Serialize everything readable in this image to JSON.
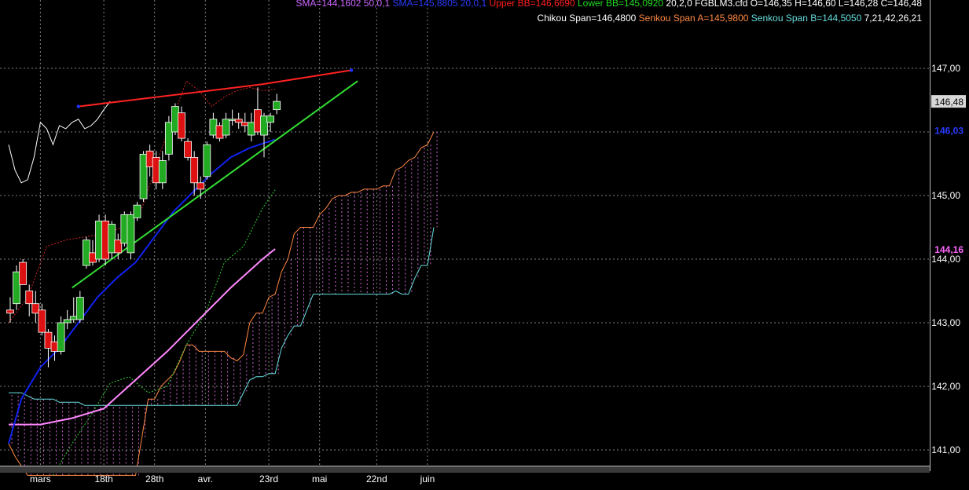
{
  "header": {
    "line1": [
      {
        "text": "SMA=144,1602  50,0,1",
        "color": "#cc66ff"
      },
      {
        "text": "SMA=145,8805  20,0,1",
        "color": "#2a3bff"
      },
      {
        "text": "Upper BB=146,6690",
        "color": "#ff2020"
      },
      {
        "text": "Lower BB=145,0920",
        "color": "#22dd22"
      },
      {
        "text": "20,2,0",
        "color": "#ffffff"
      },
      {
        "text": "FGBLM3.cfd O=146,35 H=146,60 L=146,28 C=146,48",
        "color": "#ffffff"
      }
    ],
    "line2": [
      {
        "text": "Chikou Span=146,4800",
        "color": "#ffffff"
      },
      {
        "text": "Senkou Span A=145,9800",
        "color": "#ff8844"
      },
      {
        "text": "Senkou Span B=144,5050",
        "color": "#66dddd"
      },
      {
        "text": "7,21,42,26,21",
        "color": "#ffffff"
      }
    ]
  },
  "price_badges": [
    {
      "label": "146,48",
      "value": 146.48,
      "bg": "#d8d8d8",
      "fg": "#000000"
    },
    {
      "label": "146,03",
      "value": 146.03,
      "bg": "#000000",
      "fg": "#2a3bff"
    },
    {
      "label": "144,16",
      "value": 144.16,
      "bg": "#000000",
      "fg": "#ff66ff"
    }
  ],
  "colors": {
    "up": "#22aa22",
    "down": "#dd1111",
    "sma50": "#ff88ff",
    "sma20": "#1122ee",
    "bb": "#cc2222",
    "bb_lower": "#33cc33",
    "chikou": "#ffffff",
    "senkou_a": "#ff8844",
    "senkou_b": "#66dddd",
    "cloud": "#cc66cc",
    "trend_red": "#ff2222",
    "trend_green": "#33dd33",
    "grid": "#808080"
  },
  "chart_data": {
    "type": "candlestick",
    "title": "",
    "xlabel": "",
    "ylabel": "",
    "ylim": [
      140.6,
      147.6
    ],
    "grid": true,
    "yticks": [
      141,
      142,
      143,
      144,
      145,
      146,
      147
    ],
    "ytick_labels": [
      "141,00",
      "142,00",
      "143,00",
      "144,00",
      "145,00",
      "146,00",
      "147,00"
    ],
    "x_count": 84,
    "xticks": [
      {
        "label": "mars",
        "i": 5
      },
      {
        "label": "18th",
        "i": 15
      },
      {
        "label": "28th",
        "i": 23
      },
      {
        "label": "avr.",
        "i": 31
      },
      {
        "label": "23rd",
        "i": 41
      },
      {
        "label": "mai",
        "i": 49
      },
      {
        "label": "22nd",
        "i": 58
      },
      {
        "label": "juin",
        "i": 66
      }
    ],
    "candles": [
      {
        "i": 0,
        "o": 143.2,
        "h": 143.4,
        "l": 143.0,
        "c": 143.15
      },
      {
        "i": 1,
        "o": 143.3,
        "h": 143.9,
        "l": 143.2,
        "c": 143.8
      },
      {
        "i": 2,
        "o": 143.95,
        "h": 144.0,
        "l": 143.6,
        "c": 143.6
      },
      {
        "i": 3,
        "o": 143.5,
        "h": 143.6,
        "l": 143.1,
        "c": 143.3
      },
      {
        "i": 4,
        "o": 143.3,
        "h": 143.5,
        "l": 143.0,
        "c": 143.15
      },
      {
        "i": 5,
        "o": 143.2,
        "h": 143.3,
        "l": 142.8,
        "c": 142.85
      },
      {
        "i": 6,
        "o": 142.85,
        "h": 142.9,
        "l": 142.3,
        "c": 142.6
      },
      {
        "i": 7,
        "o": 142.7,
        "h": 142.8,
        "l": 142.4,
        "c": 142.55
      },
      {
        "i": 8,
        "o": 142.55,
        "h": 143.1,
        "l": 142.5,
        "c": 143.0
      },
      {
        "i": 9,
        "o": 143.0,
        "h": 143.2,
        "l": 142.9,
        "c": 143.05
      },
      {
        "i": 10,
        "o": 143.05,
        "h": 143.4,
        "l": 143.0,
        "c": 143.1
      },
      {
        "i": 11,
        "o": 143.05,
        "h": 143.5,
        "l": 143.0,
        "c": 143.4
      },
      {
        "i": 12,
        "o": 143.9,
        "h": 144.35,
        "l": 143.85,
        "c": 144.3
      },
      {
        "i": 13,
        "o": 144.1,
        "h": 144.3,
        "l": 143.9,
        "c": 143.95
      },
      {
        "i": 14,
        "o": 144.0,
        "h": 144.7,
        "l": 143.95,
        "c": 144.6
      },
      {
        "i": 15,
        "o": 144.6,
        "h": 144.7,
        "l": 143.9,
        "c": 144.0
      },
      {
        "i": 16,
        "o": 144.1,
        "h": 144.6,
        "l": 144.0,
        "c": 144.55
      },
      {
        "i": 17,
        "o": 144.3,
        "h": 144.4,
        "l": 144.0,
        "c": 144.1
      },
      {
        "i": 18,
        "o": 144.25,
        "h": 144.75,
        "l": 144.2,
        "c": 144.7
      },
      {
        "i": 19,
        "o": 144.1,
        "h": 144.75,
        "l": 144.0,
        "c": 144.7
      },
      {
        "i": 20,
        "o": 144.65,
        "h": 144.9,
        "l": 144.6,
        "c": 144.85
      },
      {
        "i": 21,
        "o": 144.95,
        "h": 145.7,
        "l": 144.9,
        "c": 145.65
      },
      {
        "i": 22,
        "o": 145.7,
        "h": 145.8,
        "l": 145.3,
        "c": 145.45
      },
      {
        "i": 23,
        "o": 145.6,
        "h": 145.7,
        "l": 145.1,
        "c": 145.2
      },
      {
        "i": 24,
        "o": 145.2,
        "h": 145.7,
        "l": 145.1,
        "c": 145.55
      },
      {
        "i": 25,
        "o": 145.65,
        "h": 146.25,
        "l": 145.55,
        "c": 146.15
      },
      {
        "i": 26,
        "o": 146.0,
        "h": 146.45,
        "l": 145.95,
        "c": 146.4
      },
      {
        "i": 27,
        "o": 146.3,
        "h": 146.4,
        "l": 145.85,
        "c": 145.9
      },
      {
        "i": 28,
        "o": 145.85,
        "h": 145.9,
        "l": 145.55,
        "c": 145.6
      },
      {
        "i": 29,
        "o": 145.6,
        "h": 145.7,
        "l": 145.0,
        "c": 145.2
      },
      {
        "i": 30,
        "o": 145.2,
        "h": 145.3,
        "l": 144.95,
        "c": 145.1
      },
      {
        "i": 31,
        "o": 145.3,
        "h": 145.85,
        "l": 145.25,
        "c": 145.8
      },
      {
        "i": 32,
        "o": 145.95,
        "h": 146.3,
        "l": 145.9,
        "c": 146.2
      },
      {
        "i": 33,
        "o": 146.1,
        "h": 146.15,
        "l": 145.85,
        "c": 145.9
      },
      {
        "i": 34,
        "o": 145.95,
        "h": 146.3,
        "l": 145.9,
        "c": 146.2
      },
      {
        "i": 35,
        "o": 146.2,
        "h": 146.35,
        "l": 146.1,
        "c": 146.2
      },
      {
        "i": 36,
        "o": 146.2,
        "h": 146.3,
        "l": 146.05,
        "c": 146.15
      },
      {
        "i": 37,
        "o": 146.15,
        "h": 146.3,
        "l": 146.0,
        "c": 146.1
      },
      {
        "i": 38,
        "o": 145.95,
        "h": 146.3,
        "l": 145.85,
        "c": 146.15
      },
      {
        "i": 39,
        "o": 146.35,
        "h": 146.7,
        "l": 145.95,
        "c": 146.0
      },
      {
        "i": 40,
        "o": 145.95,
        "h": 146.3,
        "l": 145.6,
        "c": 146.25
      },
      {
        "i": 41,
        "o": 146.15,
        "h": 146.3,
        "l": 146.0,
        "c": 146.25
      },
      {
        "i": 42,
        "o": 146.35,
        "h": 146.6,
        "l": 146.28,
        "c": 146.48
      }
    ],
    "series": [
      {
        "key": "sma50",
        "x": [
          0,
          5,
          10,
          15,
          20,
          25,
          30,
          35,
          40,
          42
        ],
        "y": [
          141.4,
          141.4,
          141.5,
          141.65,
          142.1,
          142.55,
          143.05,
          143.55,
          144.0,
          144.16
        ]
      },
      {
        "key": "sma20",
        "x": [
          0,
          2,
          5,
          8,
          11,
          14,
          17,
          20,
          23,
          26,
          29,
          32,
          35,
          38,
          41,
          42
        ],
        "y": [
          141.1,
          141.8,
          142.3,
          142.6,
          143.0,
          143.4,
          143.7,
          143.95,
          144.35,
          144.75,
          145.05,
          145.35,
          145.6,
          145.75,
          145.85,
          145.88
        ]
      },
      {
        "key": "bb_upper",
        "x": [
          0,
          3,
          6,
          9,
          12,
          15,
          18,
          21,
          24,
          26,
          28,
          30,
          32,
          34,
          36,
          38,
          40,
          42
        ],
        "y": [
          143.0,
          143.4,
          144.2,
          144.3,
          144.35,
          144.4,
          144.5,
          144.8,
          145.7,
          146.25,
          146.8,
          146.65,
          146.4,
          146.55,
          146.65,
          146.7,
          146.65,
          146.67
        ]
      },
      {
        "key": "bb_lower",
        "x": [
          7,
          10,
          13,
          16,
          19,
          22,
          25,
          28,
          31,
          34,
          37,
          40,
          42
        ],
        "y": [
          140.6,
          141.1,
          141.55,
          142.05,
          142.15,
          141.9,
          142.0,
          142.65,
          143.15,
          143.95,
          144.2,
          144.8,
          145.09
        ]
      },
      {
        "key": "chikou",
        "x": [
          0,
          1,
          2,
          3,
          4,
          5,
          6,
          7,
          8,
          9,
          10,
          11,
          12,
          13,
          14,
          15,
          16
        ],
        "y": [
          145.8,
          145.4,
          145.2,
          145.25,
          145.6,
          146.15,
          146.05,
          145.8,
          146.1,
          146.05,
          146.15,
          146.2,
          146.05,
          146.1,
          146.2,
          146.35,
          146.48
        ]
      },
      {
        "key": "senkou_a",
        "x": [
          0,
          1,
          2,
          3,
          4,
          5,
          6,
          7,
          8,
          9,
          10,
          11,
          12,
          13,
          14,
          15,
          16,
          17,
          18,
          19,
          20,
          21,
          22,
          23,
          24,
          25,
          26,
          27,
          28,
          29,
          30,
          31,
          32,
          33,
          34,
          35,
          36,
          37,
          38,
          39,
          40,
          41,
          42,
          43,
          44,
          45,
          46,
          47,
          48,
          49,
          50,
          51,
          52,
          53,
          54,
          55,
          56,
          57,
          58,
          59,
          60,
          61,
          62,
          63,
          64,
          65,
          66,
          67
        ],
        "y": [
          141.1,
          140.9,
          140.75,
          140.6,
          140.6,
          140.6,
          140.6,
          140.6,
          140.6,
          140.6,
          140.6,
          140.6,
          140.6,
          140.6,
          140.6,
          140.6,
          140.6,
          140.6,
          140.6,
          140.6,
          140.6,
          141.2,
          141.8,
          141.8,
          142.0,
          142.1,
          142.2,
          142.4,
          142.65,
          142.65,
          142.55,
          142.55,
          142.55,
          142.55,
          142.55,
          142.45,
          142.4,
          142.5,
          143.0,
          143.15,
          143.15,
          143.4,
          143.45,
          143.8,
          144.0,
          144.4,
          144.5,
          144.5,
          144.5,
          144.7,
          144.8,
          144.95,
          145.0,
          145.0,
          145.05,
          145.05,
          145.1,
          145.1,
          145.1,
          145.15,
          145.15,
          145.4,
          145.45,
          145.55,
          145.6,
          145.75,
          145.8,
          146.0
        ]
      },
      {
        "key": "senkou_b",
        "x": [
          0,
          1,
          2,
          3,
          4,
          5,
          6,
          7,
          8,
          9,
          10,
          11,
          12,
          13,
          14,
          15,
          16,
          17,
          18,
          19,
          20,
          21,
          22,
          23,
          24,
          25,
          26,
          27,
          28,
          29,
          30,
          31,
          32,
          33,
          34,
          35,
          36,
          37,
          38,
          39,
          40,
          41,
          42,
          43,
          44,
          45,
          46,
          47,
          48,
          49,
          50,
          51,
          52,
          53,
          54,
          55,
          56,
          57,
          58,
          59,
          60,
          61,
          62,
          63,
          64,
          65,
          66,
          67
        ],
        "y": [
          141.9,
          141.9,
          141.9,
          141.85,
          141.8,
          141.8,
          141.8,
          141.8,
          141.75,
          141.75,
          141.75,
          141.75,
          141.7,
          141.7,
          141.7,
          141.7,
          141.7,
          141.7,
          141.7,
          141.7,
          141.7,
          141.7,
          141.7,
          141.7,
          141.7,
          141.7,
          141.7,
          141.7,
          141.7,
          141.7,
          141.7,
          141.7,
          141.7,
          141.7,
          141.7,
          141.7,
          141.7,
          141.9,
          142.1,
          142.15,
          142.15,
          142.2,
          142.2,
          142.6,
          142.8,
          142.95,
          142.95,
          143.2,
          143.45,
          143.45,
          143.45,
          143.45,
          143.45,
          143.45,
          143.45,
          143.45,
          143.45,
          143.45,
          143.45,
          143.45,
          143.45,
          143.5,
          143.45,
          143.45,
          143.7,
          143.9,
          143.9,
          144.5
        ]
      },
      {
        "key": "trend_red",
        "x": [
          11,
          40,
          54
        ],
        "y": [
          146.4,
          146.75,
          146.97
        ]
      },
      {
        "key": "trend_green",
        "x": [
          10,
          55
        ],
        "y": [
          143.55,
          146.8
        ]
      }
    ]
  }
}
